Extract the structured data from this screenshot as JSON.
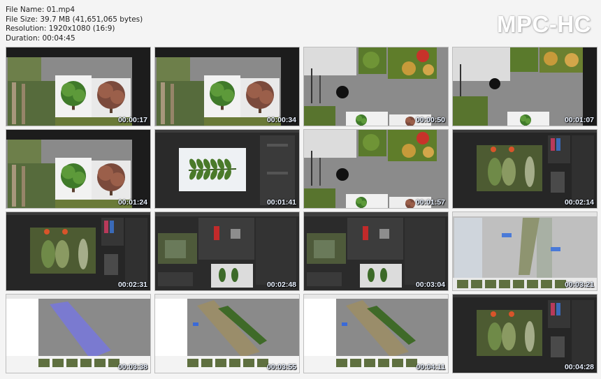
{
  "file_info": {
    "file_name": "File Name: 01.mp4",
    "file_size": "File Size: 39.7 MB (41,651,065 bytes)",
    "resolution": "Resolution: 1920x1080 (16:9)",
    "duration": "Duration: 00:04:45"
  },
  "brand": "MPC-HC",
  "thumbnails": [
    {
      "time": "00:00:17",
      "scene": "trees"
    },
    {
      "time": "00:00:34",
      "scene": "trees"
    },
    {
      "time": "00:00:50",
      "scene": "foliage"
    },
    {
      "time": "00:01:07",
      "scene": "foliage2"
    },
    {
      "time": "00:01:24",
      "scene": "trees"
    },
    {
      "time": "00:01:41",
      "scene": "leaf"
    },
    {
      "time": "00:01:57",
      "scene": "foliage"
    },
    {
      "time": "00:02:14",
      "scene": "editor"
    },
    {
      "time": "00:02:31",
      "scene": "editor"
    },
    {
      "time": "00:02:48",
      "scene": "material"
    },
    {
      "time": "00:03:04",
      "scene": "material"
    },
    {
      "time": "00:03:21",
      "scene": "scan"
    },
    {
      "time": "00:03:38",
      "scene": "trunk-blue"
    },
    {
      "time": "00:03:55",
      "scene": "trunk"
    },
    {
      "time": "00:04:11",
      "scene": "trunk"
    },
    {
      "time": "00:04:28",
      "scene": "editor"
    }
  ]
}
